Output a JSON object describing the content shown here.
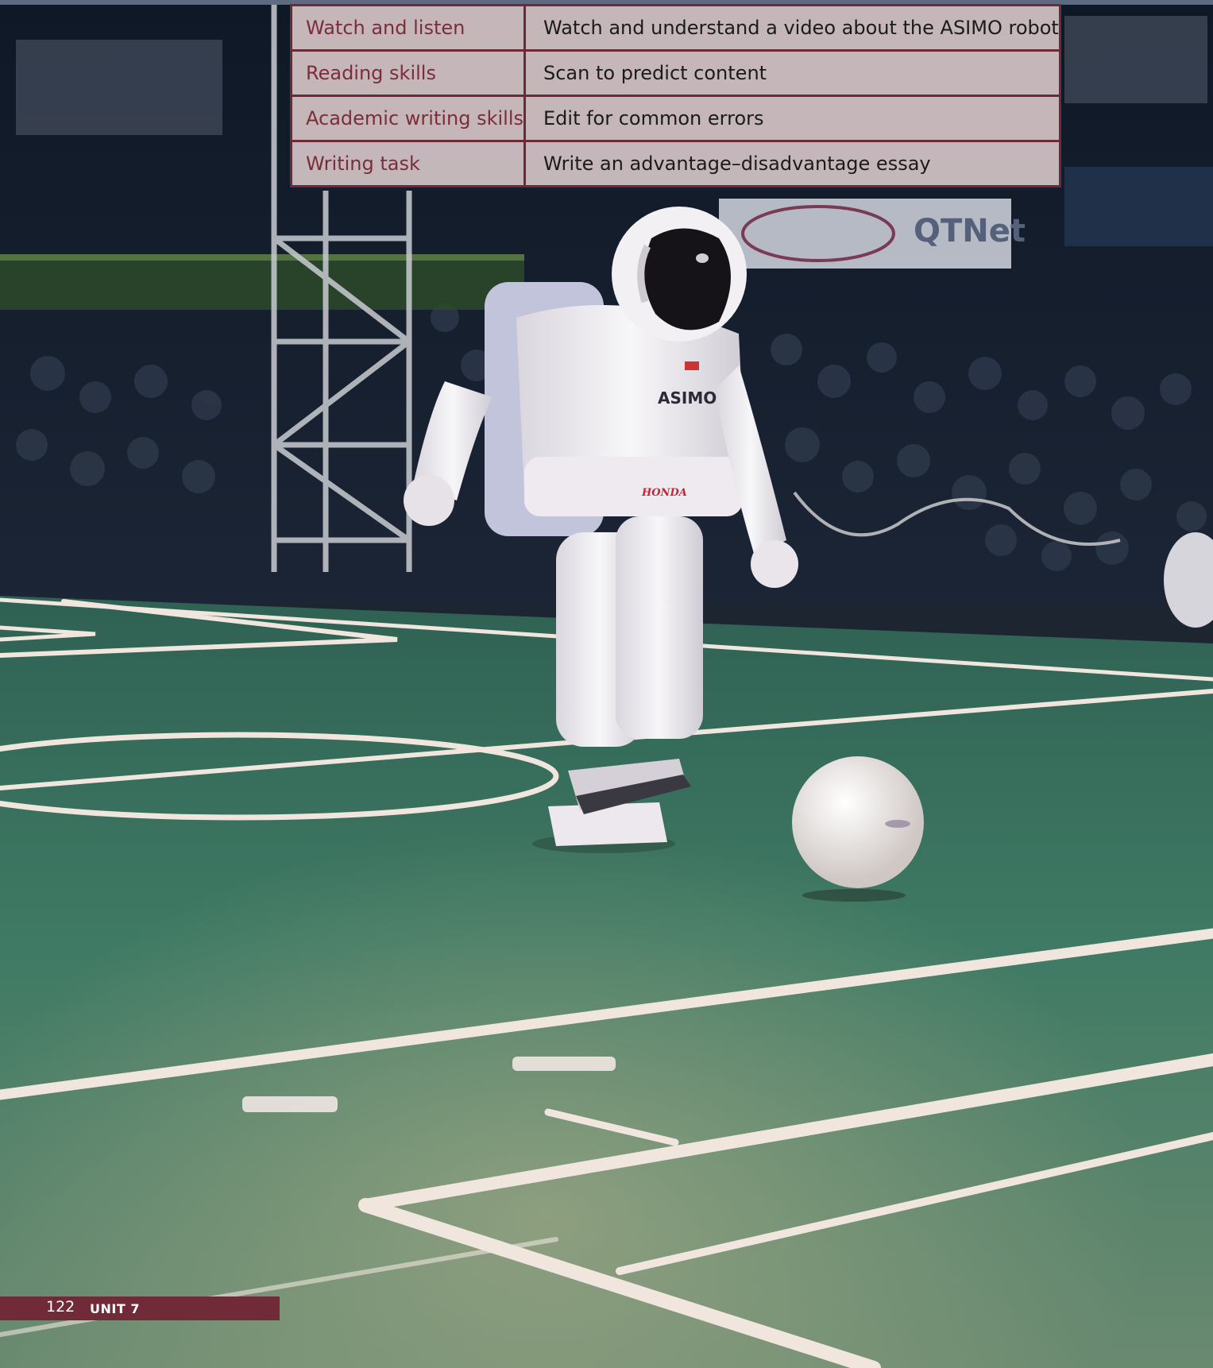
{
  "skills_table": {
    "rows": [
      {
        "label": "Watch and listen",
        "value": "Watch and understand a video about the ASIMO robot"
      },
      {
        "label": "Reading skills",
        "value": "Scan to predict content"
      },
      {
        "label": "Academic writing skills",
        "value": "Edit for common errors"
      },
      {
        "label": "Writing task",
        "value": "Write an advantage–disadvantage essay"
      }
    ]
  },
  "photo": {
    "robot_chest_text": "ASIMO",
    "robot_waist_text": "HONDA",
    "sign_text": "QTNet"
  },
  "footer": {
    "page_number": "122",
    "unit": "UNIT 7"
  },
  "colors": {
    "accent": "#712a37",
    "table_fill": "#e2d0d2",
    "court_green": "#3f7a64"
  }
}
